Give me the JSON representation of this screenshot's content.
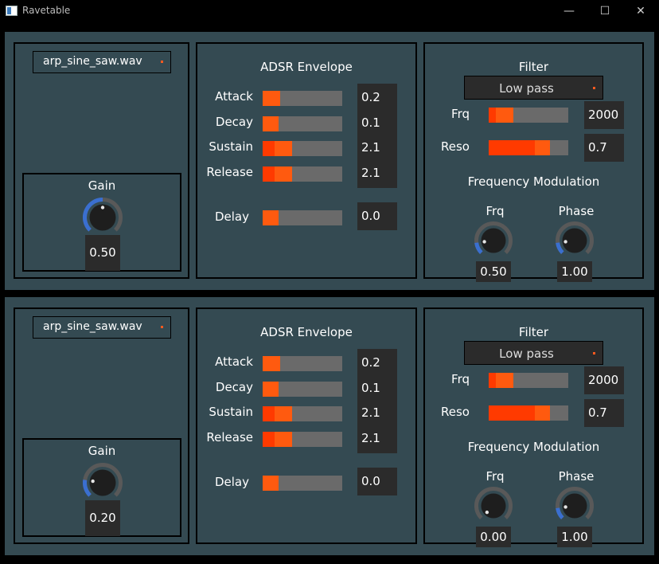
{
  "window": {
    "title": "Ravetable",
    "minimize_icon": "—",
    "maximize_icon": "☐",
    "close_icon": "✕"
  },
  "accent_color": "#ff5a0f",
  "panel_bg": "#344a52",
  "instruments": [
    {
      "file": "arp_sine_saw.wav",
      "gain": {
        "label": "Gain",
        "value": "0.50",
        "level": 0.5
      },
      "adsr": {
        "title": "ADSR Envelope",
        "params": [
          {
            "label": "Attack",
            "value": "0.2",
            "fill": 0.22,
            "dark": 0.0
          },
          {
            "label": "Decay",
            "value": "0.1",
            "fill": 0.2,
            "dark": 0.0
          },
          {
            "label": "Sustain",
            "value": "2.1",
            "fill": 0.37,
            "dark": 0.15
          },
          {
            "label": "Release",
            "value": "2.1",
            "fill": 0.37,
            "dark": 0.15
          }
        ],
        "delay": {
          "label": "Delay",
          "value": "0.0",
          "fill": 0.2
        }
      },
      "filter": {
        "title": "Filter",
        "type": "Low pass",
        "frq": {
          "label": "Frq",
          "value": "2000",
          "fill": 0.31,
          "dark": 0.09
        },
        "reso": {
          "label": "Reso",
          "value": "0.7",
          "fill": 0.77,
          "dark": 0.58
        }
      },
      "fm": {
        "title": "Frequency Modulation",
        "frq": {
          "label": "Frq",
          "value": "0.50",
          "level": 0.14
        },
        "phase": {
          "label": "Phase",
          "value": "1.00",
          "level": 0.14
        }
      }
    },
    {
      "file": "arp_sine_saw.wav",
      "gain": {
        "label": "Gain",
        "value": "0.20",
        "level": 0.2
      },
      "adsr": {
        "title": "ADSR Envelope",
        "params": [
          {
            "label": "Attack",
            "value": "0.2",
            "fill": 0.22,
            "dark": 0.0
          },
          {
            "label": "Decay",
            "value": "0.1",
            "fill": 0.2,
            "dark": 0.0
          },
          {
            "label": "Sustain",
            "value": "2.1",
            "fill": 0.37,
            "dark": 0.15
          },
          {
            "label": "Release",
            "value": "2.1",
            "fill": 0.37,
            "dark": 0.15
          }
        ],
        "delay": {
          "label": "Delay",
          "value": "0.0",
          "fill": 0.2
        }
      },
      "filter": {
        "title": "Filter",
        "type": "Low pass",
        "frq": {
          "label": "Frq",
          "value": "2000",
          "fill": 0.31,
          "dark": 0.09
        },
        "reso": {
          "label": "Reso",
          "value": "0.7",
          "fill": 0.77,
          "dark": 0.58
        }
      },
      "fm": {
        "title": "Frequency Modulation",
        "frq": {
          "label": "Frq",
          "value": "0.00",
          "level": 0.0
        },
        "phase": {
          "label": "Phase",
          "value": "1.00",
          "level": 0.14
        }
      }
    }
  ]
}
